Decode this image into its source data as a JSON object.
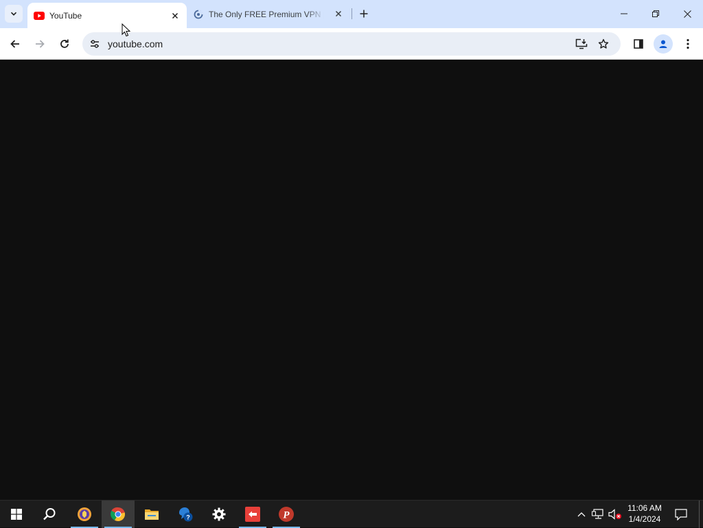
{
  "browser": {
    "tabs": [
      {
        "title": "YouTube",
        "active": true,
        "favicon": "youtube-icon"
      },
      {
        "title": "The Only FREE Premium VPN | Psiphon",
        "active": false,
        "favicon": "psiphon-loading-icon"
      }
    ],
    "address_bar": {
      "url": "youtube.com"
    },
    "icons": {
      "tab_search": "chevron-down-icon",
      "new_tab": "plus-icon",
      "back": "arrow-left-icon",
      "forward": "arrow-right-icon",
      "reload": "reload-icon",
      "site_info": "tune-icon",
      "install": "install-app-icon",
      "bookmark": "star-icon",
      "side_panel": "side-panel-icon",
      "profile": "profile-icon",
      "menu": "kebab-menu-icon"
    }
  },
  "page": {
    "background": "#0f0f0f"
  },
  "taskbar": {
    "items": [
      "start-icon",
      "search-icon",
      "vpn-app-icon",
      "chrome-icon",
      "file-explorer-icon",
      "help-icon",
      "settings-icon",
      "app-icon",
      "psiphon-icon"
    ],
    "clock": {
      "time": "11:06 AM",
      "date": "1/4/2024"
    }
  },
  "colors": {
    "tab_strip": "#d3e3fd",
    "omnibox": "#e9eef6",
    "taskbar": "#1c1c1c",
    "youtube_red": "#ff0000"
  }
}
